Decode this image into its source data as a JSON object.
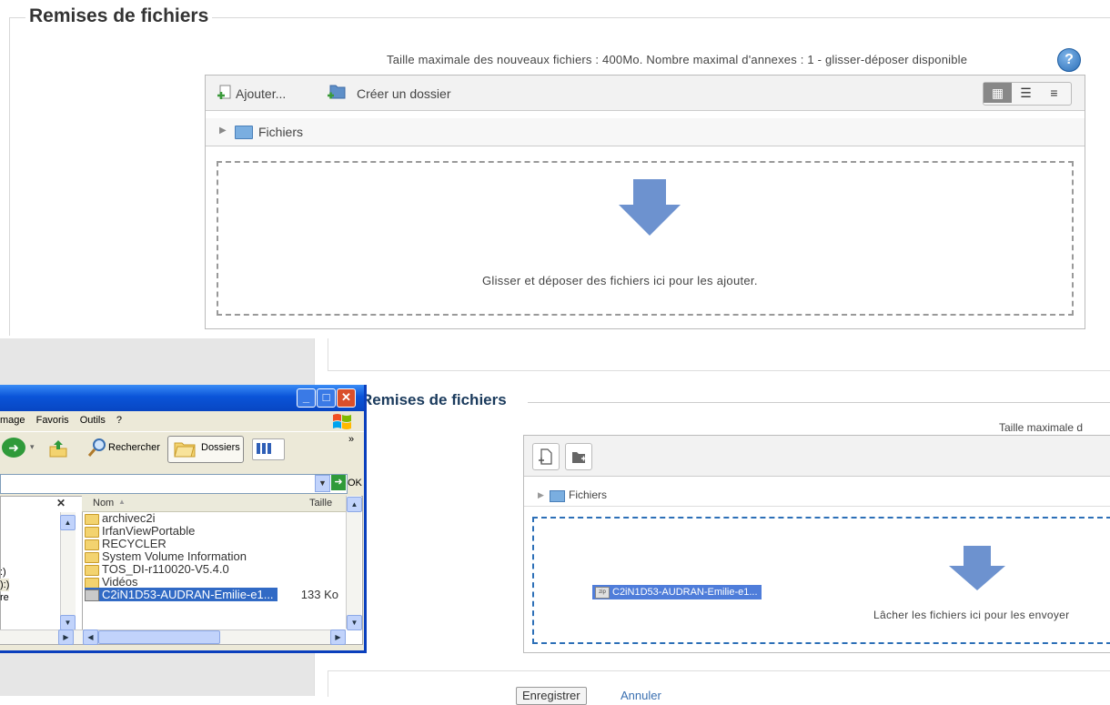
{
  "top": {
    "legend": "Remises de fichiers",
    "limit_text": "Taille maximale des nouveaux fichiers : 400Mo. Nombre maximal d'annexes : 1 - glisser-déposer disponible",
    "help_icon": "?",
    "toolbar": {
      "add_label": "Ajouter...",
      "create_folder_label": "Créer un dossier"
    },
    "path_label": "Fichiers",
    "drop_text": "Glisser et déposer des fichiers ici pour les ajouter."
  },
  "bottom": {
    "legend": "Remises de fichiers",
    "limit_text": "Taille maximale d",
    "path_label": "Fichiers",
    "drop_text": "Lâcher les fichiers ici pour les envoyer",
    "dragged_file": "C2iN1D53-AUDRAN-Emilie-e1...",
    "dragged_file_icon": "zip",
    "save_label": "Enregistrer",
    "cancel_label": "Annuler"
  },
  "explorer": {
    "menu": [
      "mage",
      "Favoris",
      "Outils",
      "?"
    ],
    "toolbar": {
      "search_label": "Rechercher",
      "folders_label": "Dossiers"
    },
    "go_label": "OK",
    "left_drives": [
      ":)",
      "):)",
      "re"
    ],
    "columns": {
      "name": "Nom",
      "size": "Taille"
    },
    "files": [
      {
        "name": "archivec2i",
        "type": "folder",
        "size": ""
      },
      {
        "name": "IrfanViewPortable",
        "type": "folder",
        "size": ""
      },
      {
        "name": "RECYCLER",
        "type": "folder",
        "size": ""
      },
      {
        "name": "System Volume Information",
        "type": "folder",
        "size": ""
      },
      {
        "name": "TOS_DI-r110020-V5.4.0",
        "type": "folder",
        "size": ""
      },
      {
        "name": "Vidéos",
        "type": "folder",
        "size": ""
      },
      {
        "name": "C2iN1D53-AUDRAN-Emilie-e1...",
        "type": "zip",
        "size": "133 Ko",
        "selected": true
      }
    ]
  }
}
